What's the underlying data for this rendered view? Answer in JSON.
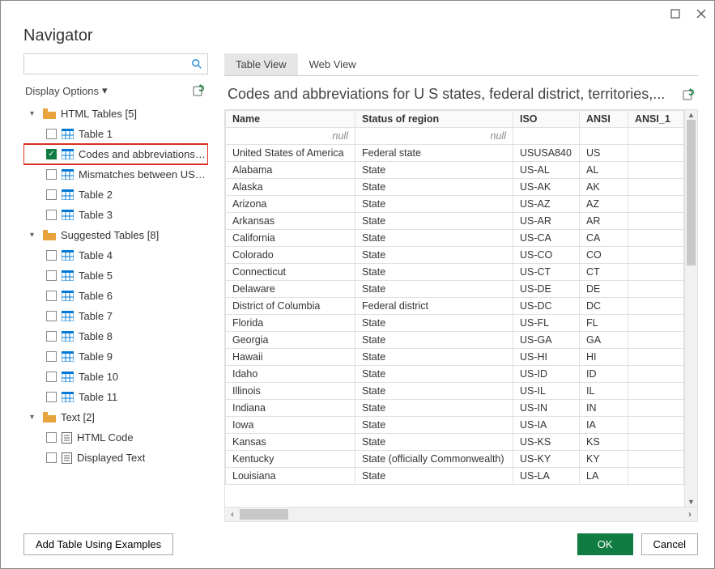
{
  "window": {
    "title": "Navigator"
  },
  "left": {
    "search_placeholder": "",
    "display_options": "Display Options",
    "groups": [
      {
        "label": "HTML Tables [5]"
      },
      {
        "label": "Suggested Tables [8]"
      },
      {
        "label": "Text [2]"
      }
    ],
    "html_tables": [
      {
        "label": "Table 1",
        "checked": false
      },
      {
        "label": "Codes and abbreviations f...",
        "checked": true,
        "highlight": true
      },
      {
        "label": "Mismatches between USP...",
        "checked": false
      },
      {
        "label": "Table 2",
        "checked": false
      },
      {
        "label": "Table 3",
        "checked": false
      }
    ],
    "suggested": [
      {
        "label": "Table 4"
      },
      {
        "label": "Table 5"
      },
      {
        "label": "Table 6"
      },
      {
        "label": "Table 7"
      },
      {
        "label": "Table 8"
      },
      {
        "label": "Table 9"
      },
      {
        "label": "Table 10"
      },
      {
        "label": "Table 11"
      }
    ],
    "text_items": [
      {
        "label": "HTML Code"
      },
      {
        "label": "Displayed Text"
      }
    ]
  },
  "tabs": {
    "table_view": "Table View",
    "web_view": "Web View"
  },
  "preview": {
    "title": "Codes and abbreviations for U S states, federal district, territories,...",
    "columns": [
      "Name",
      "Status of region",
      "ISO",
      "ANSI",
      "ANSI_1"
    ],
    "filter_null": "null",
    "rows": [
      [
        "United States of America",
        "Federal state",
        "USUSA840",
        "US",
        ""
      ],
      [
        "Alabama",
        "State",
        "US-AL",
        "AL",
        ""
      ],
      [
        "Alaska",
        "State",
        "US-AK",
        "AK",
        ""
      ],
      [
        "Arizona",
        "State",
        "US-AZ",
        "AZ",
        ""
      ],
      [
        "Arkansas",
        "State",
        "US-AR",
        "AR",
        ""
      ],
      [
        "California",
        "State",
        "US-CA",
        "CA",
        ""
      ],
      [
        "Colorado",
        "State",
        "US-CO",
        "CO",
        ""
      ],
      [
        "Connecticut",
        "State",
        "US-CT",
        "CT",
        ""
      ],
      [
        "Delaware",
        "State",
        "US-DE",
        "DE",
        ""
      ],
      [
        "District of Columbia",
        "Federal district",
        "US-DC",
        "DC",
        ""
      ],
      [
        "Florida",
        "State",
        "US-FL",
        "FL",
        ""
      ],
      [
        "Georgia",
        "State",
        "US-GA",
        "GA",
        ""
      ],
      [
        "Hawaii",
        "State",
        "US-HI",
        "HI",
        ""
      ],
      [
        "Idaho",
        "State",
        "US-ID",
        "ID",
        ""
      ],
      [
        "Illinois",
        "State",
        "US-IL",
        "IL",
        ""
      ],
      [
        "Indiana",
        "State",
        "US-IN",
        "IN",
        ""
      ],
      [
        "Iowa",
        "State",
        "US-IA",
        "IA",
        ""
      ],
      [
        "Kansas",
        "State",
        "US-KS",
        "KS",
        ""
      ],
      [
        "Kentucky",
        "State (officially Commonwealth)",
        "US-KY",
        "KY",
        ""
      ],
      [
        "Louisiana",
        "State",
        "US-LA",
        "LA",
        ""
      ]
    ]
  },
  "footer": {
    "add_examples": "Add Table Using Examples",
    "ok": "OK",
    "cancel": "Cancel"
  }
}
